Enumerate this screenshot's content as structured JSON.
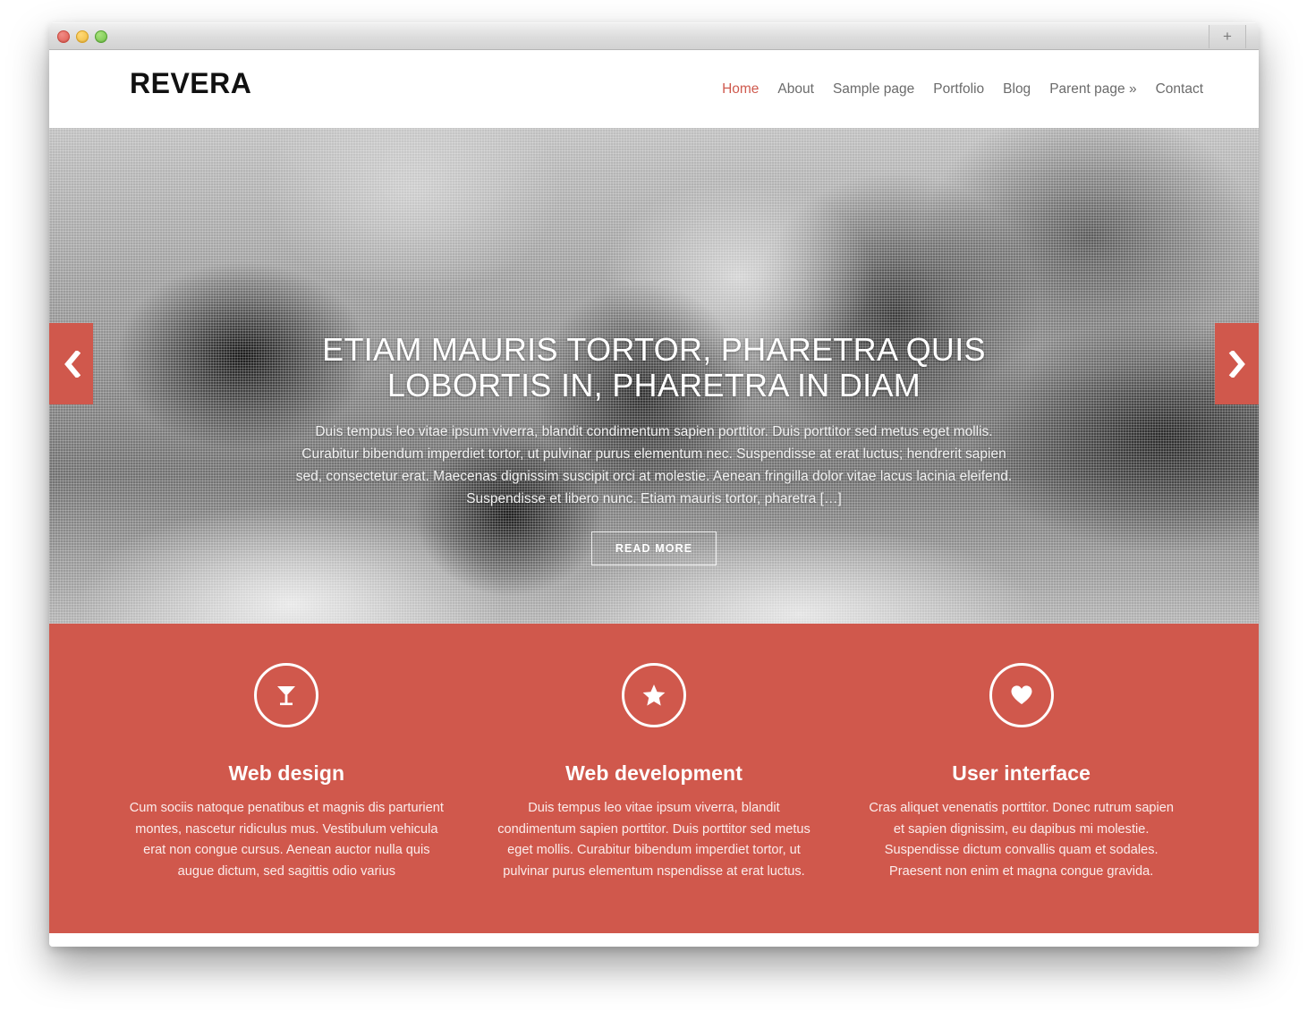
{
  "browser": {
    "traffic_lights": [
      "close",
      "minimize",
      "maximize"
    ],
    "new_tab_label": "+"
  },
  "colors": {
    "accent": "#d0584c",
    "nav_active": "#cf5a4e",
    "nav_default": "#6b6b6b",
    "logo": "#111111"
  },
  "header": {
    "logo": "REVERA",
    "nav": [
      {
        "label": "Home",
        "active": true
      },
      {
        "label": "About",
        "active": false
      },
      {
        "label": "Sample page",
        "active": false
      },
      {
        "label": "Portfolio",
        "active": false
      },
      {
        "label": "Blog",
        "active": false
      },
      {
        "label": "Parent page »",
        "active": false
      },
      {
        "label": "Contact",
        "active": false
      }
    ]
  },
  "hero": {
    "title": "ETIAM MAURIS TORTOR, PHARETRA QUIS LOBORTIS IN, PHARETRA IN DIAM",
    "text": "Duis tempus leo vitae ipsum viverra, blandit condimentum sapien porttitor. Duis porttitor sed metus eget mollis. Curabitur bibendum imperdiet tortor, ut pulvinar purus elementum nec. Suspendisse at erat luctus; hendrerit sapien sed, consectetur erat. Maecenas dignissim suscipit orci at molestie. Aenean fringilla dolor vitae lacus lacinia eleifend. Suspendisse et libero nunc. Etiam mauris tortor, pharetra […]",
    "read_more": "READ MORE",
    "prev_icon": "chevron-left-icon",
    "next_icon": "chevron-right-icon",
    "image_description": "grayscale photo of two sleeping kittens"
  },
  "features": [
    {
      "icon": "cocktail-glass-icon",
      "title": "Web design",
      "body": "Cum sociis natoque penatibus et magnis dis parturient montes, nascetur ridiculus mus. Vestibulum vehicula erat non congue cursus. Aenean auctor nulla quis augue dictum, sed sagittis odio varius"
    },
    {
      "icon": "star-icon",
      "title": "Web development",
      "body": "Duis tempus leo vitae ipsum viverra, blandit condimentum sapien porttitor. Duis porttitor sed metus eget mollis. Curabitur bibendum imperdiet tortor, ut pulvinar purus elementum nspendisse at erat luctus."
    },
    {
      "icon": "heart-icon",
      "title": "User interface",
      "body": "Cras aliquet venenatis porttitor. Donec rutrum sapien et sapien dignissim, eu dapibus mi molestie. Suspendisse dictum convallis quam et sodales. Praesent non enim et magna congue gravida."
    }
  ]
}
